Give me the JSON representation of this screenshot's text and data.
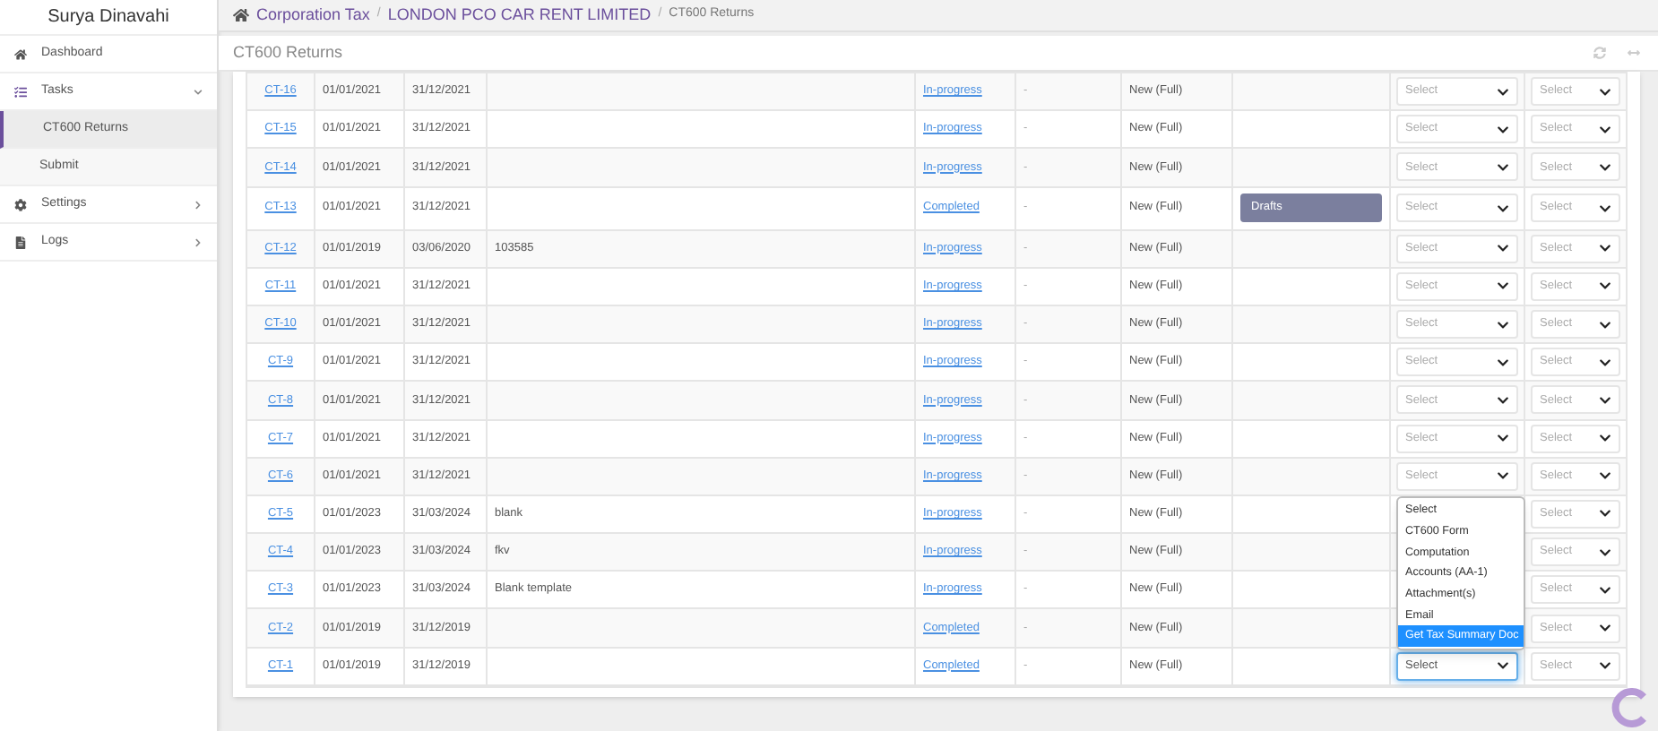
{
  "sidebar": {
    "user": "Surya Dinavahi",
    "items": [
      {
        "label": "Dashboard"
      },
      {
        "label": "Tasks",
        "expanded": true,
        "children": [
          {
            "label": "CT600 Returns",
            "selected": true
          },
          {
            "label": "Submit",
            "selected": false
          }
        ]
      },
      {
        "label": "Settings"
      },
      {
        "label": "Logs"
      }
    ]
  },
  "breadcrumb": [
    {
      "kind": "link",
      "text": "Corporation Tax"
    },
    {
      "kind": "separator",
      "text": "/"
    },
    {
      "kind": "link",
      "text": "LONDON PCO CAR RENT LIMITED"
    },
    {
      "kind": "separator",
      "text": "/"
    },
    {
      "kind": "current",
      "text": "CT600 Returns"
    }
  ],
  "panel": {
    "title": "CT600 Returns"
  },
  "table": {
    "rows": [
      {
        "id": "CT-16",
        "start": "01/01/2021",
        "end": "31/12/2021",
        "status": "In-progress",
        "dash": "-",
        "type": "New (Full)",
        "select_1": "Select",
        "select_2": "Select"
      },
      {
        "id": "CT-15",
        "start": "01/01/2021",
        "end": "31/12/2021",
        "status": "In-progress",
        "dash": "-",
        "type": "New (Full)",
        "select_1": "Select",
        "select_2": "Select"
      },
      {
        "id": "CT-14",
        "start": "01/01/2021",
        "end": "31/12/2021",
        "status": "In-progress",
        "dash": "-",
        "type": "New (Full)",
        "select_1": "Select",
        "select_2": "Select"
      },
      {
        "id": "CT-13",
        "start": "01/01/2021",
        "end": "31/12/2021",
        "status": "Completed",
        "dash": "-",
        "type": "New (Full)",
        "action": "Drafts",
        "select_1": "Select",
        "select_2": "Select"
      },
      {
        "id": "CT-12",
        "start": "01/01/2019",
        "end": "03/06/2020",
        "notes": "103585",
        "status": "In-progress",
        "dash": "-",
        "type": "New (Full)",
        "select_1": "Select",
        "select_2": "Select"
      },
      {
        "id": "CT-11",
        "start": "01/01/2021",
        "end": "31/12/2021",
        "status": "In-progress",
        "dash": "-",
        "type": "New (Full)",
        "select_1": "Select",
        "select_2": "Select"
      },
      {
        "id": "CT-10",
        "start": "01/01/2021",
        "end": "31/12/2021",
        "status": "In-progress",
        "dash": "-",
        "type": "New (Full)",
        "select_1": "Select",
        "select_2": "Select"
      },
      {
        "id": "CT-9",
        "start": "01/01/2021",
        "end": "31/12/2021",
        "status": "In-progress",
        "dash": "-",
        "type": "New (Full)",
        "select_1": "Select",
        "select_2": "Select"
      },
      {
        "id": "CT-8",
        "start": "01/01/2021",
        "end": "31/12/2021",
        "status": "In-progress",
        "dash": "-",
        "type": "New (Full)",
        "select_1": "Select",
        "select_2": "Select"
      },
      {
        "id": "CT-7",
        "start": "01/01/2021",
        "end": "31/12/2021",
        "status": "In-progress",
        "dash": "-",
        "type": "New (Full)",
        "select_1": "Select",
        "select_2": "Select"
      },
      {
        "id": "CT-6",
        "start": "01/01/2021",
        "end": "31/12/2021",
        "status": "In-progress",
        "dash": "-",
        "type": "New (Full)",
        "select_1": "Select",
        "select_2": "Select"
      },
      {
        "id": "CT-5",
        "start": "01/01/2023",
        "end": "31/03/2024",
        "notes": "blank",
        "status": "In-progress",
        "dash": "-",
        "type": "New (Full)",
        "select_2": "Select"
      },
      {
        "id": "CT-4",
        "start": "01/01/2023",
        "end": "31/03/2024",
        "notes": "fkv",
        "status": "In-progress",
        "dash": "-",
        "type": "New (Full)",
        "select_2": "Select"
      },
      {
        "id": "CT-3",
        "start": "01/01/2023",
        "end": "31/03/2024",
        "notes": "Blank template",
        "status": "In-progress",
        "dash": "-",
        "type": "New (Full)",
        "select_2": "Select"
      },
      {
        "id": "CT-2",
        "start": "01/01/2019",
        "end": "31/12/2019",
        "status": "Completed",
        "dash": "-",
        "type": "New (Full)",
        "select_2": "Select"
      },
      {
        "id": "CT-1",
        "start": "01/01/2019",
        "end": "31/12/2019",
        "status": "Completed",
        "dash": "-",
        "type": "New (Full)",
        "select_1": "Select",
        "select_2": "Select",
        "open": true,
        "options": [
          {
            "label": "Select",
            "selected": false
          },
          {
            "label": "CT600 Form",
            "selected": false
          },
          {
            "label": "Computation",
            "selected": false
          },
          {
            "label": "Accounts (AA-1)",
            "selected": false
          },
          {
            "label": "Attachment(s)",
            "selected": false
          },
          {
            "label": "Email",
            "selected": false
          },
          {
            "label": "Get Tax Summary Doc",
            "selected": true
          }
        ]
      }
    ]
  }
}
